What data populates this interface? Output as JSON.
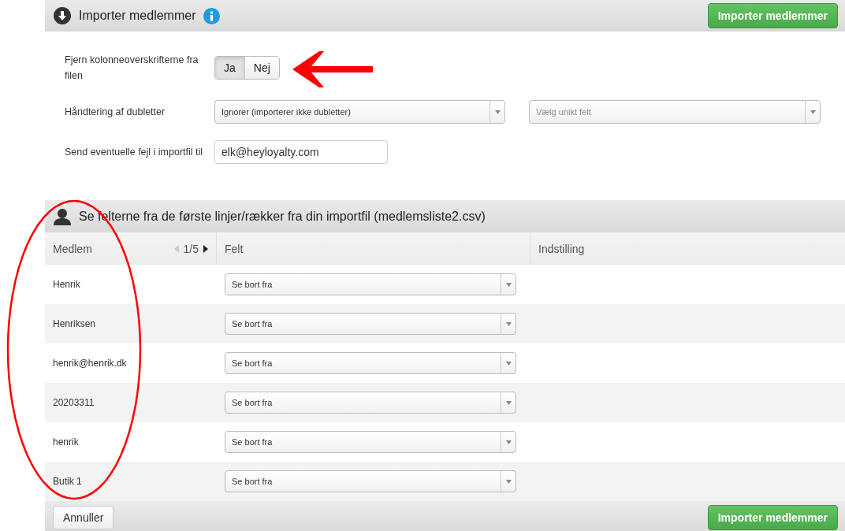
{
  "header": {
    "title": "Importer medlemmer",
    "button": "Importer medlemmer"
  },
  "form": {
    "remove_headers": {
      "label": "Fjern kolonneoverskrifterne fra filen",
      "options": [
        {
          "label": "Ja",
          "selected": true
        },
        {
          "label": "Nej",
          "selected": false
        }
      ]
    },
    "duplicates": {
      "label": "Håndtering af dubletter",
      "value": "Ignorer (importerer ikke dubletter)",
      "unique_field_placeholder": "Vælg unikt felt"
    },
    "errors_email": {
      "label": "Send eventuelle fejl i importfil til",
      "value": "elk@heyloyalty.com"
    }
  },
  "preview": {
    "title": "Se felterne fra de første linjer/rækker fra din importfil (medlemsliste2.csv)",
    "columns": [
      {
        "label": "Medlem",
        "pager": "1/5",
        "prev_disabled": true
      },
      {
        "label": "Felt"
      },
      {
        "label": "Indstilling"
      }
    ],
    "rows": [
      {
        "value": "Henrik",
        "field": "Se bort fra"
      },
      {
        "value": "Henriksen",
        "field": "Se bort fra"
      },
      {
        "value": "henrik@henrik.dk",
        "field": "Se bort fra"
      },
      {
        "value": "20203311",
        "field": "Se bort fra"
      },
      {
        "value": "henrik",
        "field": "Se bort fra"
      },
      {
        "value": "Butik 1",
        "field": "Se bort fra"
      }
    ]
  },
  "footer": {
    "cancel": "Annuller",
    "submit": "Importer medlemmer"
  },
  "annotations": [
    {
      "kind": "arrow"
    },
    {
      "kind": "ellipse"
    }
  ]
}
